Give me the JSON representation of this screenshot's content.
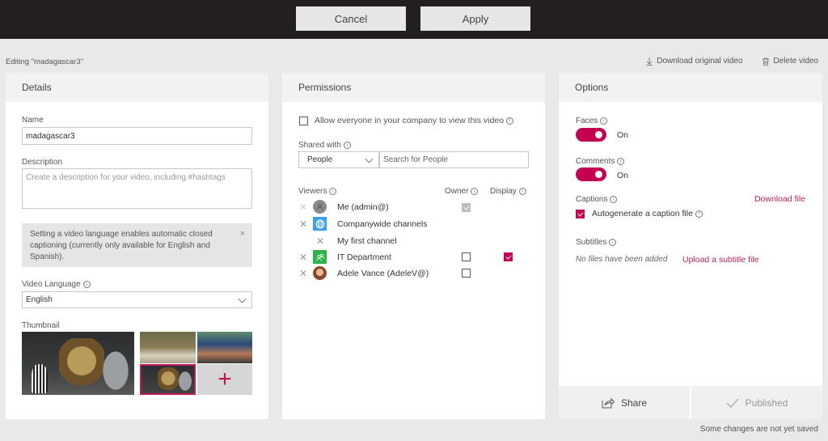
{
  "topbar": {
    "cancel_label": "Cancel",
    "apply_label": "Apply"
  },
  "header": {
    "editing_label": "Editing \"madagascar3\"",
    "download_label": "Download original video",
    "delete_label": "Delete video"
  },
  "details": {
    "title": "Details",
    "name_label": "Name",
    "name_value": "madagascar3",
    "description_label": "Description",
    "description_placeholder": "Create a description for your video, including #hashtags",
    "notice_text": "Setting a video language enables automatic closed captioning (currently only available for English and Spanish).",
    "notice_close": "×",
    "language_label": "Video Language",
    "language_value": "English",
    "thumbnail_label": "Thumbnail",
    "add_thumbnail_icon": "+"
  },
  "permissions": {
    "title": "Permissions",
    "allow_everyone_label": "Allow everyone in your company to view this video",
    "allow_everyone_checked": false,
    "shared_with_label": "Shared with",
    "shared_type_value": "People",
    "search_placeholder": "Search for People",
    "viewers_label": "Viewers",
    "owner_label": "Owner",
    "display_label": "Display",
    "viewers": [
      {
        "name": "Me (admin@)",
        "icon": "person-icon",
        "owner": "checked-disabled",
        "display": null
      },
      {
        "name": "Companywide channels",
        "icon": "globe-icon",
        "owner": null,
        "display": null
      },
      {
        "name": "My first channel",
        "icon": null,
        "owner": null,
        "display": null
      },
      {
        "name": "IT Department",
        "icon": "group-icon",
        "owner": "unchecked",
        "display": "checked"
      },
      {
        "name": "Adele Vance (AdeleV@)",
        "icon": "photo-avatar",
        "owner": "unchecked",
        "display": null
      }
    ]
  },
  "options": {
    "title": "Options",
    "faces_label": "Faces",
    "faces_state": "On",
    "comments_label": "Comments",
    "comments_state": "On",
    "captions_label": "Captions",
    "download_file_label": "Download file",
    "autogenerate_label": "Autogenerate a caption file",
    "autogenerate_checked": true,
    "subtitles_label": "Subtitles",
    "no_files_text": "No files have been added",
    "upload_label": "Upload a subtitle file",
    "share_label": "Share",
    "published_label": "Published"
  },
  "status": {
    "save_status": "Some changes are not yet saved"
  },
  "colors": {
    "accent": "#c30052",
    "link": "#b4245d",
    "topbar": "#231f20"
  }
}
